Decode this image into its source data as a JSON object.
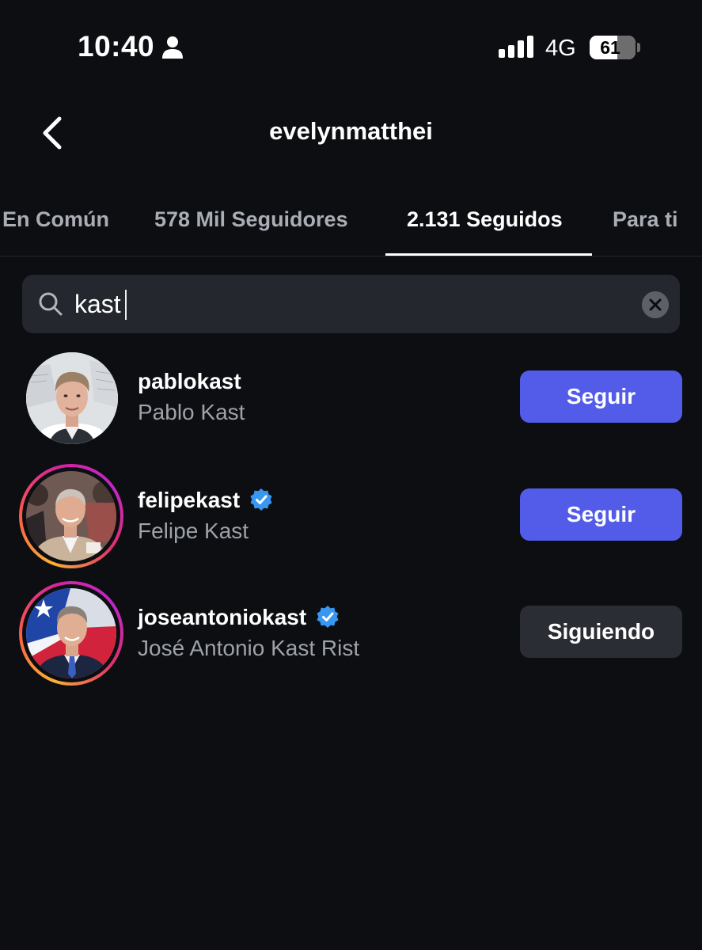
{
  "status_bar": {
    "time": "10:40",
    "network": "4G",
    "battery_level": "61",
    "battery_fraction": 0.61
  },
  "header": {
    "title": "evelynmatthei",
    "back_icon": "chevron-left-icon"
  },
  "tabs": [
    {
      "label": "En Común",
      "active": false
    },
    {
      "label": "578 Mil Seguidores",
      "active": false
    },
    {
      "label": "2.131 Seguidos",
      "active": true
    },
    {
      "label": "Para ti",
      "active": false
    }
  ],
  "search": {
    "value": "kast",
    "icon": "search-icon",
    "clear_icon": "close-circle-icon"
  },
  "results": [
    {
      "username": "pablokast",
      "full_name": "Pablo Kast",
      "verified": false,
      "has_story": false,
      "button": "Seguir"
    },
    {
      "username": "felipekast",
      "full_name": "Felipe Kast",
      "verified": true,
      "has_story": true,
      "button": "Seguir"
    },
    {
      "username": "joseantoniokast",
      "full_name": "José Antonio Kast Rist",
      "verified": true,
      "has_story": true,
      "button": "Siguiendo"
    }
  ],
  "colors": {
    "background": "#0c0e12",
    "follow_button": "#525ce8",
    "following_button": "#2a2d33",
    "verified": "#3897f0",
    "active_tab": "#ffffff",
    "inactive_tab": "#a9adb4"
  }
}
